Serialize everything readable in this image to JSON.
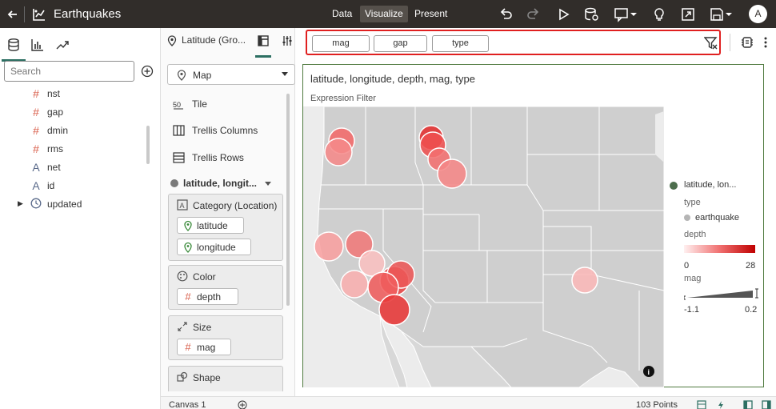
{
  "app": {
    "title": "Earthquakes",
    "modes": [
      "Data",
      "Visualize",
      "Present"
    ],
    "active_mode": "Visualize",
    "user_initial": "A"
  },
  "data_panel": {
    "search_placeholder": "Search",
    "fields": [
      {
        "name": "nst",
        "type": "number"
      },
      {
        "name": "gap",
        "type": "number"
      },
      {
        "name": "dmin",
        "type": "number"
      },
      {
        "name": "rms",
        "type": "number"
      },
      {
        "name": "net",
        "type": "text"
      },
      {
        "name": "id",
        "type": "text"
      },
      {
        "name": "updated",
        "type": "time"
      }
    ]
  },
  "grammar": {
    "header": "Latitude (Gro...",
    "viz_type": "Map",
    "items": [
      "Tile",
      "Trellis Columns",
      "Trellis Rows"
    ],
    "layer": "latitude, longit...",
    "category_label": "Category (Location)",
    "category_fields": [
      "latitude",
      "longitude"
    ],
    "color_label": "Color",
    "color_field": "depth",
    "size_label": "Size",
    "size_field": "mag",
    "shape_label": "Shape"
  },
  "filters": [
    "mag",
    "gap",
    "type"
  ],
  "viz": {
    "title": "latitude, longitude, depth, mag, type",
    "subtitle": "Expression Filter"
  },
  "legend": {
    "layer": "latitude, lon...",
    "type_label": "type",
    "type_value": "earthquake",
    "depth_label": "depth",
    "depth_min": "0",
    "depth_max": "28",
    "mag_label": "mag",
    "mag_min": "-1.1",
    "mag_max": "0.2"
  },
  "colors": {
    "brand_bar": "#312d2a",
    "accent": "#2c6f62",
    "filter_highlight": "#e02020",
    "bubble": "#f04040"
  },
  "bottom": {
    "canvas_tab": "Canvas 1",
    "points": "103 Points"
  }
}
